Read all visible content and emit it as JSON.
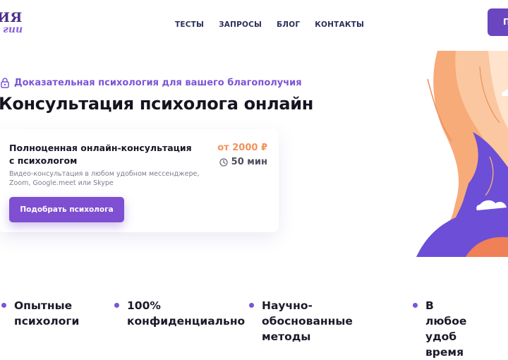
{
  "header": {
    "logo_top": "ИЯ",
    "logo_bottom": "гии",
    "nav": [
      "ТЕСТЫ",
      "ЗАПРОСЫ",
      "БЛОГ",
      "КОНТАКТЫ"
    ],
    "cta_label": "П"
  },
  "hero": {
    "tagline": "Доказательная психология для вашего благополучия",
    "title": "Консультация психолога онлайн"
  },
  "card": {
    "title": "Полноценная онлайн-консультация с психологом",
    "description": "Видео-консультация в любом удобном мессенджере, Zoom, Google.meet или Skype",
    "price": "от 2000 ₽",
    "duration": "50 мин",
    "button_label": "Подобрать психолога"
  },
  "features": [
    "Опытные\nпсихологи",
    "100%\nконфиденциально",
    "Научно-обоснованные\nметоды",
    "В любое удоб\nвремя"
  ],
  "colors": {
    "accent": "#7a55d6",
    "button": "#7e4fd1",
    "price": "#f0925a",
    "illustration_orange": "#f5a977",
    "illustration_purple": "#6c4fd6"
  }
}
